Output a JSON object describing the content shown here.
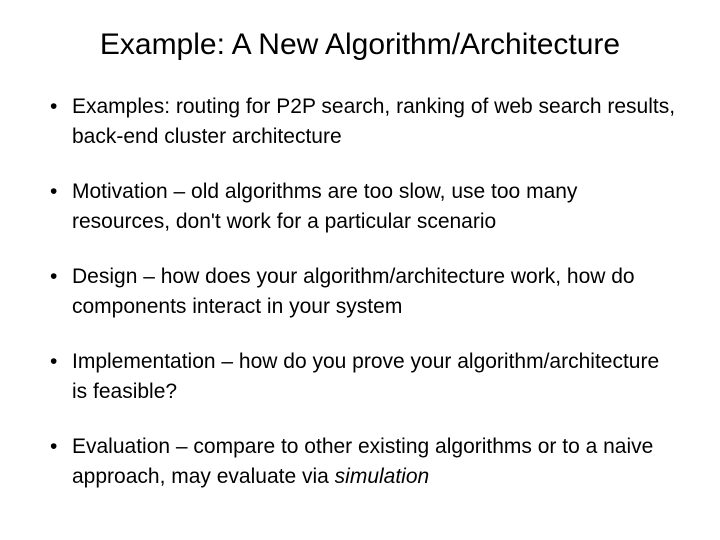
{
  "title": "Example: A New Algorithm/Architecture",
  "bullets": {
    "b0": "Examples: routing for P2P search, ranking of web search results, back-end cluster architecture",
    "b1": "Motivation – old algorithms are too slow, use too many resources, don't work for a particular scenario",
    "b2": "Design – how does your algorithm/architecture work, how do components interact in your system",
    "b3": "Implementation – how do you prove your algorithm/architecture is feasible?",
    "b4_pre": "Evaluation – compare to other existing algorithms or to a naive approach, may evaluate via ",
    "b4_em": "simulation"
  }
}
